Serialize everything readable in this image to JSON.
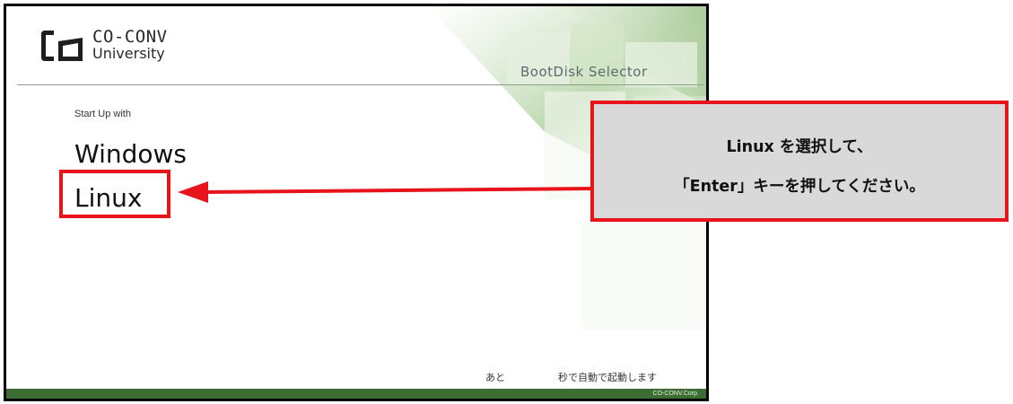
{
  "brand": {
    "line1": "CO-CONV",
    "line2": "University"
  },
  "screen_title": "BootDisk Selector",
  "startup_label": "Start Up with",
  "options": [
    {
      "label": "Windows",
      "selected": false
    },
    {
      "label": "Linux",
      "selected": true
    }
  ],
  "countdown": {
    "prefix": "あと",
    "suffix": "秒で自動で起動します"
  },
  "footer_brand": "CO-CONV.Corp.",
  "callout": {
    "line1": "Linux を選択して、",
    "line2": "「Enter」キーを押してください。"
  },
  "colors": {
    "highlight": "#e8141b",
    "footer_green": "#3c6e33",
    "callout_bg": "#d9d9d9"
  }
}
